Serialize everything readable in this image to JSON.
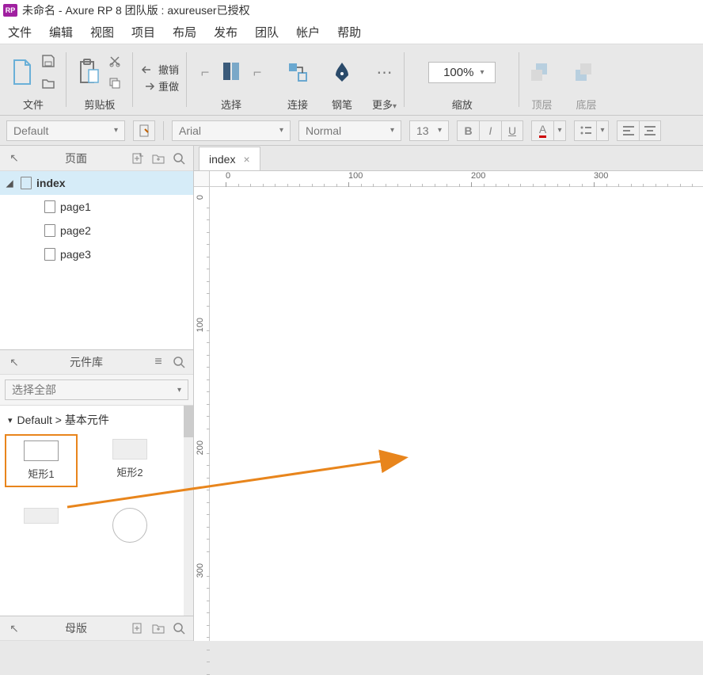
{
  "title": "未命名 - Axure RP 8 团队版 : axureuser已授权",
  "app_icon_label": "RP",
  "menu": {
    "file": "文件",
    "edit": "编辑",
    "view": "视图",
    "project": "项目",
    "layout": "布局",
    "publish": "发布",
    "team": "团队",
    "account": "帐户",
    "help": "帮助"
  },
  "toolbar": {
    "file_label": "文件",
    "clipboard_label": "剪贴板",
    "undo": "撤销",
    "redo": "重做",
    "select_label": "选择",
    "connect_label": "连接",
    "pen_label": "钢笔",
    "more_label": "更多",
    "zoom_value": "100%",
    "zoom_label": "缩放",
    "front_label": "顶层",
    "back_label": "底层"
  },
  "format": {
    "style": "Default",
    "font": "Arial",
    "weight": "Normal",
    "size": "13",
    "bold": "B",
    "italic": "I",
    "underline": "U",
    "fontcolor": "A"
  },
  "panels": {
    "pages_title": "页面",
    "pages": [
      {
        "name": "index",
        "active": true,
        "children": [
          {
            "name": "page1"
          },
          {
            "name": "page2"
          },
          {
            "name": "page3"
          }
        ]
      }
    ],
    "library_title": "元件库",
    "library_select": "选择全部",
    "library_section": "Default > 基本元件",
    "widgets": [
      {
        "name": "矩形1",
        "selected": true
      },
      {
        "name": "矩形2",
        "selected": false
      }
    ],
    "masters_title": "母版"
  },
  "canvas": {
    "active_tab": "index",
    "ruler_ticks_h": [
      0,
      100,
      200,
      300
    ],
    "ruler_ticks_v": [
      0,
      100,
      200,
      300
    ]
  }
}
